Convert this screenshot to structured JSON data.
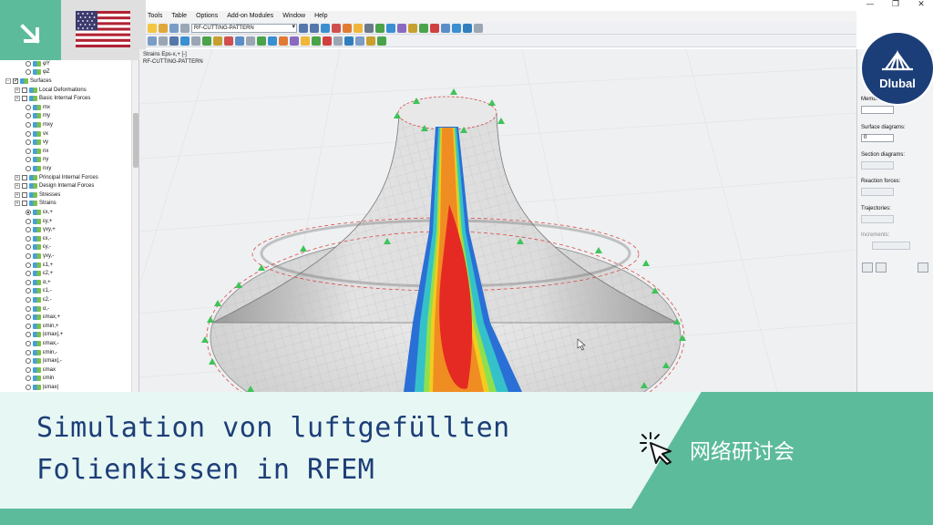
{
  "menu": [
    "Tools",
    "Table",
    "Options",
    "Add-on Modules",
    "Window",
    "Help"
  ],
  "toolbar": {
    "combo_value": "RF-CUTTING-PATTERN"
  },
  "viewport": {
    "label_result": "Strains Eps-x,+ [-]",
    "label_module": "RF-CUTTING-PATTERN"
  },
  "navigator": {
    "items": [
      {
        "text": "φY",
        "level": 3,
        "kind": "radio"
      },
      {
        "text": "φZ",
        "level": 3,
        "kind": "radio"
      },
      {
        "text": "Surfaces",
        "level": 1,
        "kind": "folder"
      },
      {
        "text": "Local Deformations",
        "level": 2,
        "kind": "folder"
      },
      {
        "text": "Basic Internal Forces",
        "level": 2,
        "kind": "folder"
      },
      {
        "text": "mx",
        "level": 3,
        "kind": "radio"
      },
      {
        "text": "my",
        "level": 3,
        "kind": "radio"
      },
      {
        "text": "mxy",
        "level": 3,
        "kind": "radio"
      },
      {
        "text": "vx",
        "level": 3,
        "kind": "radio"
      },
      {
        "text": "vy",
        "level": 3,
        "kind": "radio"
      },
      {
        "text": "nx",
        "level": 3,
        "kind": "radio"
      },
      {
        "text": "ny",
        "level": 3,
        "kind": "radio"
      },
      {
        "text": "nxy",
        "level": 3,
        "kind": "radio"
      },
      {
        "text": "Principal Internal Forces",
        "level": 2,
        "kind": "folder"
      },
      {
        "text": "Design Internal Forces",
        "level": 2,
        "kind": "folder"
      },
      {
        "text": "Stresses",
        "level": 2,
        "kind": "folder"
      },
      {
        "text": "Strains",
        "level": 2,
        "kind": "folder"
      },
      {
        "text": "εx,+",
        "level": 3,
        "kind": "radio",
        "selected": true
      },
      {
        "text": "εy,+",
        "level": 3,
        "kind": "radio"
      },
      {
        "text": "γxy,+",
        "level": 3,
        "kind": "radio"
      },
      {
        "text": "εx,-",
        "level": 3,
        "kind": "radio"
      },
      {
        "text": "εy,-",
        "level": 3,
        "kind": "radio"
      },
      {
        "text": "γxy,-",
        "level": 3,
        "kind": "radio"
      },
      {
        "text": "ε1,+",
        "level": 3,
        "kind": "radio"
      },
      {
        "text": "ε2,+",
        "level": 3,
        "kind": "radio"
      },
      {
        "text": "α,+",
        "level": 3,
        "kind": "radio"
      },
      {
        "text": "ε1,-",
        "level": 3,
        "kind": "radio"
      },
      {
        "text": "ε2,-",
        "level": 3,
        "kind": "radio"
      },
      {
        "text": "α,-",
        "level": 3,
        "kind": "radio"
      },
      {
        "text": "εmax,+",
        "level": 3,
        "kind": "radio"
      },
      {
        "text": "εmin,+",
        "level": 3,
        "kind": "radio"
      },
      {
        "text": "|εmax|,+",
        "level": 3,
        "kind": "radio"
      },
      {
        "text": "εmax,-",
        "level": 3,
        "kind": "radio"
      },
      {
        "text": "εmin,-",
        "level": 3,
        "kind": "radio"
      },
      {
        "text": "|εmax|,-",
        "level": 3,
        "kind": "radio"
      },
      {
        "text": "εmax",
        "level": 3,
        "kind": "radio"
      },
      {
        "text": "εmin",
        "level": 3,
        "kind": "radio"
      },
      {
        "text": "|εmax|",
        "level": 3,
        "kind": "radio"
      }
    ]
  },
  "panel": {
    "members_label": "Members",
    "surface_diagrams_label": "Surface diagrams:",
    "surface_diagrams_value": "0",
    "section_diagrams_label": "Section diagrams:",
    "reaction_forces_label": "Reaction forces:",
    "trajectories_label": "Trajectories:",
    "increments_label": "Increments:"
  },
  "brand": {
    "name": "Dlubal",
    "color": "#1c3e78"
  },
  "banner": {
    "title_line1": "Simulation von luftgefüllten",
    "title_line2": "Folienkissen in RFEM",
    "webinar": "网络研讨会",
    "accent": "#5cbb9b",
    "text_color": "#1c3e78"
  },
  "language_flag": "us-flag-icon"
}
